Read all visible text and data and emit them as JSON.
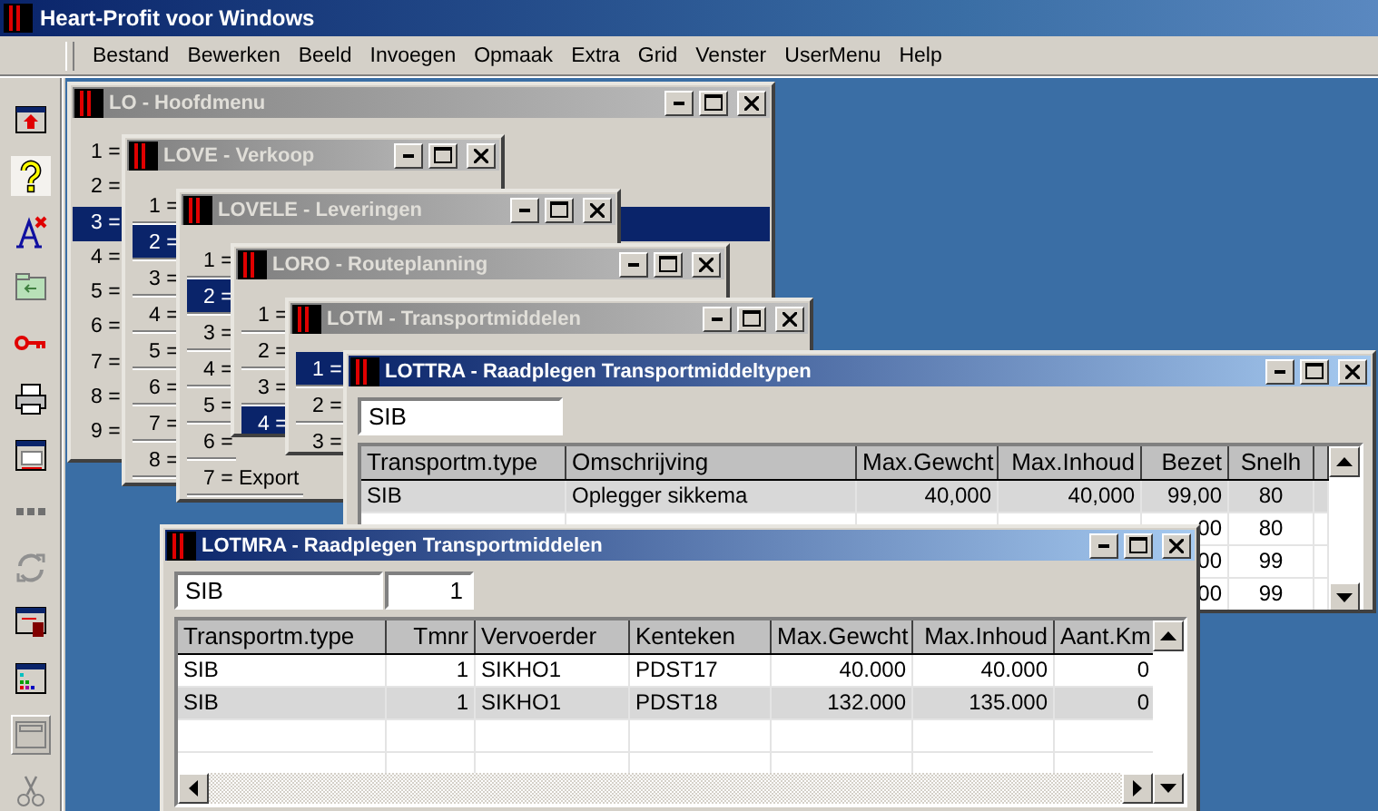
{
  "app": {
    "title": "Heart-Profit voor Windows"
  },
  "menu": [
    "Bestand",
    "Bewerken",
    "Beeld",
    "Invoegen",
    "Opmaak",
    "Extra",
    "Grid",
    "Venster",
    "UserMenu",
    "Help"
  ],
  "windows": [
    {
      "kind": "menu",
      "title": "LO - Hoofdmenu",
      "active": false,
      "items": [
        {
          "label": "1 =",
          "selected": false
        },
        {
          "label": "2 =",
          "selected": false
        },
        {
          "label": "3 =",
          "selected": true
        },
        {
          "label": "4 =",
          "selected": false
        },
        {
          "label": "5 =",
          "selected": false
        },
        {
          "label": "6 =",
          "selected": false
        },
        {
          "label": "7 =",
          "selected": false
        },
        {
          "label": "8 =",
          "selected": false
        },
        {
          "label": "9 =",
          "selected": false
        }
      ]
    },
    {
      "kind": "menu",
      "title": "LOVE - Verkoop",
      "active": false,
      "items": [
        {
          "label": "1 =",
          "selected": false
        },
        {
          "label": "2 =",
          "selected": true
        },
        {
          "label": "3 =",
          "selected": false
        },
        {
          "label": "4 =",
          "selected": false
        },
        {
          "label": "5 =",
          "selected": false
        },
        {
          "label": "6 =",
          "selected": false
        },
        {
          "label": "7 =",
          "selected": false
        },
        {
          "label": "8 =",
          "selected": false
        }
      ]
    },
    {
      "kind": "menu",
      "title": "LOVELE - Leveringen",
      "active": false,
      "items": [
        {
          "label": "1 =",
          "selected": false
        },
        {
          "label": "2 =",
          "selected": true
        },
        {
          "label": "3 =",
          "selected": false
        },
        {
          "label": "4 =",
          "selected": false
        },
        {
          "label": "5 =",
          "selected": false
        },
        {
          "label": "6 =",
          "selected": false
        },
        {
          "label": "7 = Export",
          "selected": false
        }
      ]
    },
    {
      "kind": "menu",
      "title": "LORO - Routeplanning",
      "active": false,
      "items": [
        {
          "label": "1 =",
          "selected": false
        },
        {
          "label": "2 =",
          "selected": false
        },
        {
          "label": "3 =",
          "selected": false
        },
        {
          "label": "4 =",
          "selected": true
        }
      ]
    },
    {
      "kind": "menu",
      "title": "LOTM - Transportmiddelen",
      "active": false,
      "items": [
        {
          "label": "1 =",
          "selected": true
        },
        {
          "label": "2 =",
          "selected": false
        },
        {
          "label": "3 =",
          "selected": false
        }
      ]
    },
    {
      "kind": "grid",
      "title": "LOTTRA - Raadplegen Transportmiddeltypen",
      "active": true,
      "fields": [
        {
          "value": "SIB",
          "kind": "text"
        }
      ],
      "columns": [
        {
          "label": "Transportm.type",
          "kind": "text"
        },
        {
          "label": "Omschrijving",
          "kind": "text"
        },
        {
          "label": "Max.Gewcht",
          "kind": "number"
        },
        {
          "label": "Max.Inhoud",
          "kind": "number"
        },
        {
          "label": "Bezet",
          "kind": "number"
        },
        {
          "label": "Snelh",
          "kind": "center"
        }
      ],
      "rows": [
        {
          "selected": true,
          "cells": [
            "SIB",
            "Oplegger sikkema",
            "40,000",
            "40,000",
            "99,00",
            "80"
          ]
        },
        {
          "selected": false,
          "cells": [
            null,
            null,
            null,
            null,
            "00",
            "80"
          ]
        },
        {
          "selected": false,
          "cells": [
            null,
            null,
            null,
            null,
            "00",
            "99"
          ]
        },
        {
          "selected": false,
          "cells": [
            null,
            null,
            null,
            null,
            "00",
            "99"
          ]
        }
      ]
    },
    {
      "kind": "grid",
      "title": "LOTMRA - Raadplegen Transportmiddelen",
      "active": true,
      "fields": [
        {
          "value": "SIB",
          "kind": "text"
        },
        {
          "value": "1",
          "kind": "number"
        }
      ],
      "columns": [
        {
          "label": "Transportm.type",
          "kind": "text"
        },
        {
          "label": "Tmnr",
          "kind": "number"
        },
        {
          "label": "Vervoerder",
          "kind": "text"
        },
        {
          "label": "Kenteken",
          "kind": "text"
        },
        {
          "label": "Max.Gewcht",
          "kind": "number"
        },
        {
          "label": "Max.Inhoud",
          "kind": "number"
        },
        {
          "label": "Aant.Km",
          "kind": "number"
        }
      ],
      "rows": [
        {
          "selected": false,
          "cells": [
            "SIB",
            "1",
            "SIKHO1",
            "PDST17",
            "40.000",
            "40.000",
            "0"
          ]
        },
        {
          "selected": true,
          "cells": [
            "SIB",
            "1",
            "SIKHO1",
            "PDST18",
            "132.000",
            "135.000",
            "0"
          ]
        }
      ]
    }
  ]
}
